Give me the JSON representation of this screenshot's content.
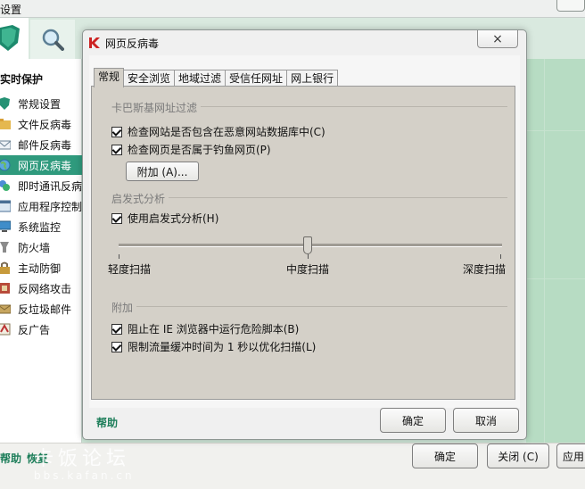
{
  "background_window": {
    "title": "设置",
    "left_heading": "实时保护",
    "nav_items": [
      {
        "label": "常规设置",
        "icon": "shield-icon"
      },
      {
        "label": "文件反病毒",
        "icon": "folder-icon"
      },
      {
        "label": "邮件反病毒",
        "icon": "mail-icon"
      },
      {
        "label": "网页反病毒",
        "icon": "globe-icon",
        "selected": true
      },
      {
        "label": "即时通讯反病",
        "icon": "chat-icon"
      },
      {
        "label": "应用程序控制",
        "icon": "window-icon"
      },
      {
        "label": "系统监控",
        "icon": "monitor-icon"
      },
      {
        "label": "防火墙",
        "icon": "firewall-icon"
      },
      {
        "label": "主动防御",
        "icon": "lock-icon"
      },
      {
        "label": "反网络攻击",
        "icon": "network-icon"
      },
      {
        "label": "反垃圾邮件",
        "icon": "envelope-icon"
      },
      {
        "label": "反广告",
        "icon": "ad-icon"
      }
    ],
    "bottom_links": {
      "help": "帮助",
      "restore": "恢复"
    },
    "buttons": {
      "ok": "确定",
      "close": "关闭 (C)",
      "apply": "应用"
    },
    "watermark": {
      "main": "卡饭论坛",
      "sub": "bbs.kafan.cn"
    }
  },
  "dialog": {
    "title": "网页反病毒",
    "tabs": [
      "常规",
      "安全浏览",
      "地域过滤",
      "受信任网址",
      "网上银行"
    ],
    "active_tab": "常规",
    "sections": {
      "url_filter": {
        "label": "卡巴斯基网址过滤",
        "checkbox_1": "检查网站是否包含在恶意网站数据库中(C)",
        "checkbox_2": "检查网页是否属于钓鱼网页(P)",
        "add_button": "附加 (A)..."
      },
      "heuristic": {
        "label": "启发式分析",
        "checkbox": "使用启发式分析(H)",
        "slider_value": "中度扫描",
        "slider_labels": {
          "low": "轻度扫描",
          "mid": "中度扫描",
          "high": "深度扫描"
        }
      },
      "extra": {
        "label": "附加",
        "checkbox_1": "阻止在 IE 浏览器中运行危险脚本(B)",
        "checkbox_2": "限制流量缓冲时间为 1 秒以优化扫描(L)"
      }
    },
    "help": "帮助",
    "buttons": {
      "ok": "确定",
      "cancel": "取消"
    },
    "close_glyph": "×"
  },
  "colors": {
    "accent": "#2f9a7d",
    "link": "#1f7f5b",
    "panel": "#d4d0c8"
  }
}
